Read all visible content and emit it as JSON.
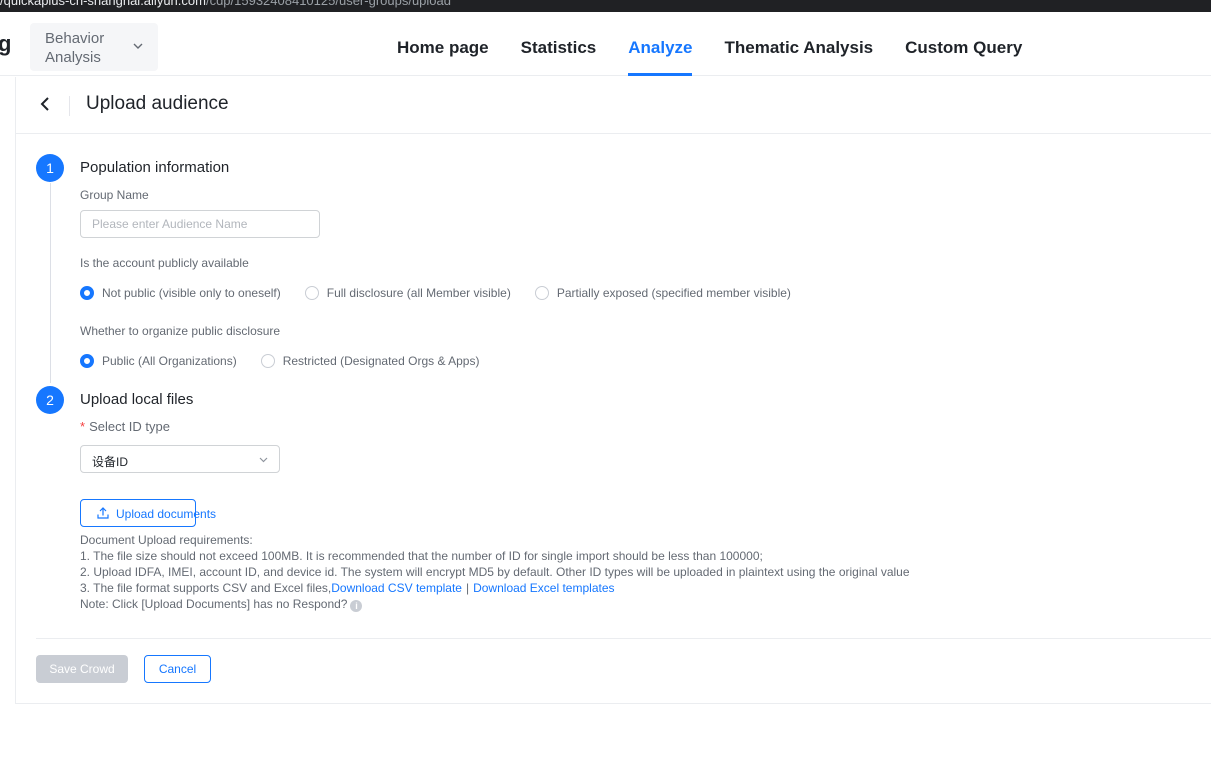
{
  "browser": {
    "url_host": "/quickaplus-cn-shanghai.aliyun.com",
    "url_path": "/cdp/15932408410125/user-groups/upload"
  },
  "topnav": {
    "brand_fragment": "g",
    "module_select": "Behavior Analysis",
    "tabs": [
      {
        "label": "Home page",
        "active": false
      },
      {
        "label": "Statistics",
        "active": false
      },
      {
        "label": "Analyze",
        "active": true
      },
      {
        "label": "Thematic Analysis",
        "active": false
      },
      {
        "label": "Custom Query",
        "active": false
      }
    ]
  },
  "page": {
    "title": "Upload audience"
  },
  "step1": {
    "number": "1",
    "title": "Population information",
    "group_name_label": "Group Name",
    "group_name_value": "",
    "group_name_placeholder": "Please enter Audience Name",
    "public_label": "Is the account publicly available",
    "public_options": [
      {
        "label": "Not public (visible only to oneself)",
        "checked": true
      },
      {
        "label": "Full disclosure (all Member visible)",
        "checked": false
      },
      {
        "label": "Partially exposed (specified member visible)",
        "checked": false
      }
    ],
    "org_label": "Whether to organize public disclosure",
    "org_options": [
      {
        "label": "Public (All Organizations)",
        "checked": true
      },
      {
        "label": "Restricted (Designated Orgs & Apps)",
        "checked": false
      }
    ]
  },
  "step2": {
    "number": "2",
    "title": "Upload local files",
    "required_mark": "*",
    "id_type_label": "Select ID type",
    "id_type_value": "设备ID",
    "upload_button": "Upload documents",
    "requirements": {
      "heading": "Document Upload requirements:",
      "line1": "1. The file size should not exceed 100MB. It is recommended that the number of ID for single import should be less than 100000;",
      "line2": "2. Upload IDFA, IMEI, account ID, and device id. The system will encrypt MD5 by default. Other ID types will be uploaded in plaintext using the original value",
      "line3_prefix": "3. The file format supports CSV and Excel files,",
      "csv_link": "Download CSV template",
      "separator": "|",
      "excel_link": "Download Excel templates",
      "note": "Note: Click [Upload Documents] has no Respond?",
      "info_glyph": "i"
    }
  },
  "footer": {
    "save_label": "Save Crowd",
    "cancel_label": "Cancel"
  },
  "colors": {
    "accent": "#1677ff",
    "disabled": "#c9cdd4",
    "required": "#f53f3f"
  },
  "icons": {
    "back": "chevron-left-icon",
    "dropdown": "chevron-down-icon",
    "upload": "upload-icon",
    "info": "info-icon"
  }
}
